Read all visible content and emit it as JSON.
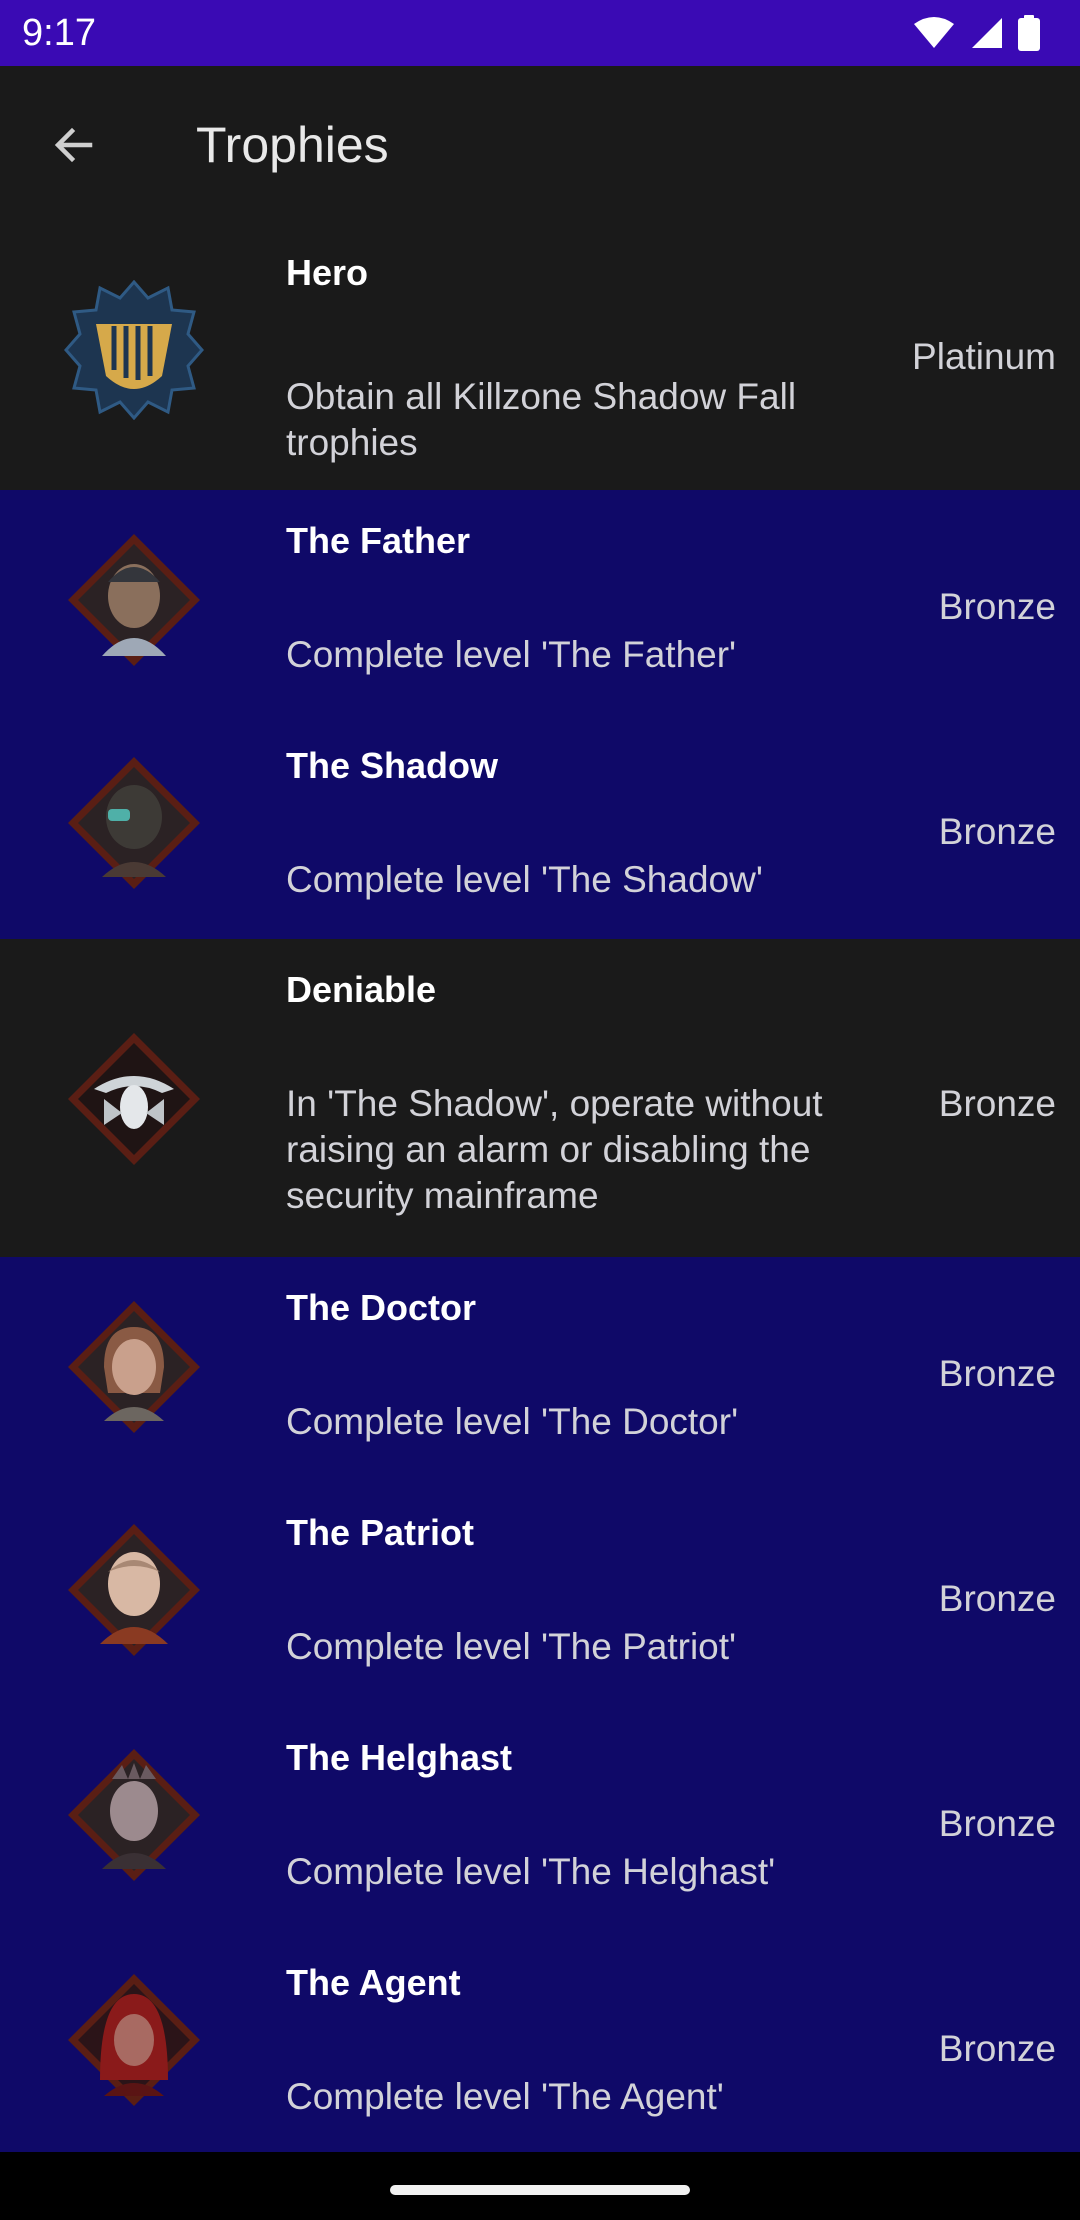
{
  "status_bar": {
    "time": "9:17"
  },
  "app_bar": {
    "title": "Trophies"
  },
  "trophies": [
    {
      "name": "Hero",
      "description": "Obtain all Killzone Shadow Fall trophies",
      "grade": "Platinum"
    },
    {
      "name": "The Father",
      "description": "Complete level 'The Father'",
      "grade": "Bronze"
    },
    {
      "name": "The Shadow",
      "description": "Complete level 'The Shadow'",
      "grade": "Bronze"
    },
    {
      "name": "Deniable",
      "description": "In 'The Shadow', operate without raising an alarm or disabling the security mainframe",
      "grade": "Bronze"
    },
    {
      "name": "The Doctor",
      "description": "Complete level 'The Doctor'",
      "grade": "Bronze"
    },
    {
      "name": "The Patriot",
      "description": "Complete level 'The Patriot'",
      "grade": "Bronze"
    },
    {
      "name": "The Helghast",
      "description": "Complete level 'The Helghast'",
      "grade": "Bronze"
    },
    {
      "name": "The Agent",
      "description": "Complete level 'The Agent'",
      "grade": "Bronze"
    }
  ],
  "colors": {
    "status_bar": "#3a0ab4",
    "background_dark": "#1a1a1a",
    "background_blue": "#0f0968",
    "platinum_icon": "#d6a94a",
    "bronze_frame": "#6a2a1a"
  },
  "icons": {
    "back": "arrow-back-icon",
    "wifi": "wifi-icon",
    "signal": "signal-icon",
    "battery": "battery-icon"
  }
}
